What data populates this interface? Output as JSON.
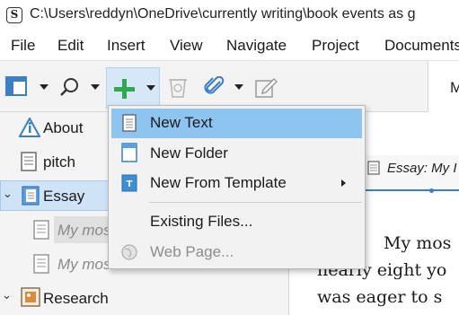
{
  "titlebar": {
    "logo_letter": "S",
    "title": "C:\\Users\\reddyn\\OneDrive\\currently writing\\book events as g"
  },
  "menubar": {
    "items": [
      "File",
      "Edit",
      "Insert",
      "View",
      "Navigate",
      "Project",
      "Documents"
    ]
  },
  "toolbar": {
    "tab_label": "M",
    "buttons": [
      "binder-toggle-icon",
      "search-icon",
      "add-icon",
      "trash-icon",
      "attachment-icon",
      "edit-icon"
    ]
  },
  "binder": {
    "items": [
      {
        "label": "About",
        "icon": "info-icon"
      },
      {
        "label": "pitch",
        "icon": "document-icon"
      },
      {
        "label": "Essay",
        "icon": "folder-icon",
        "selected": true,
        "expanded": true
      },
      {
        "label": "My mos",
        "icon": "document-icon"
      },
      {
        "label": "My mos",
        "icon": "document-icon"
      },
      {
        "label": "Research",
        "icon": "research-icon",
        "expanded": true
      }
    ]
  },
  "editor": {
    "header_title": "Essay: My I",
    "lines": [
      "My mos",
      "nearly eight yo",
      "was eager to s"
    ]
  },
  "dropdown": {
    "items": [
      {
        "label": "New Text",
        "icon": "text-document-icon",
        "highlighted": true
      },
      {
        "label": "New Folder",
        "icon": "folder-icon"
      },
      {
        "label": "New From Template",
        "icon": "template-icon",
        "submenu": true
      },
      {
        "label": "Existing Files...",
        "icon": ""
      },
      {
        "label": "Web Page...",
        "icon": "globe-icon",
        "disabled": true
      }
    ]
  },
  "colors": {
    "highlight": "#8ec4f0",
    "selection": "#cfe3f7",
    "add_green": "#2fa84f",
    "accent_blue": "#3a7dc9"
  }
}
